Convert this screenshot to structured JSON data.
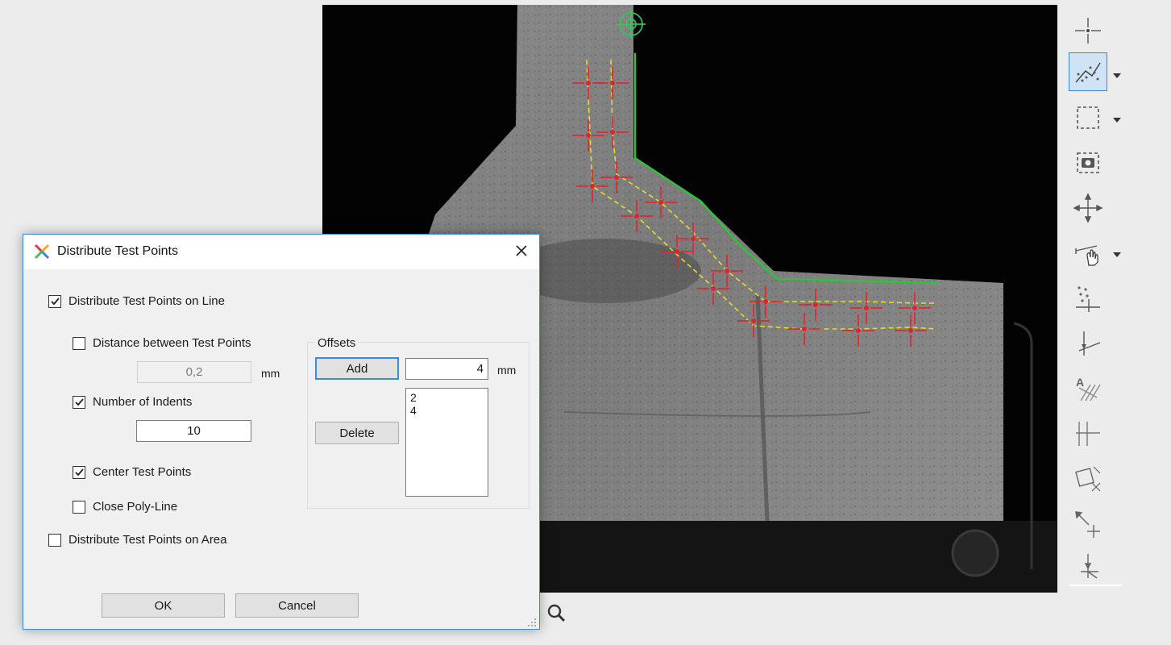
{
  "dialog": {
    "title": "Distribute Test Points",
    "close_label": "✕",
    "distribute_on_line": {
      "label": "Distribute Test Points on Line",
      "checked": true
    },
    "distance_between": {
      "label": "Distance between Test Points",
      "checked": false,
      "value": "0,2",
      "unit": "mm"
    },
    "number_of_indents": {
      "label": "Number of Indents",
      "checked": true,
      "value": "10"
    },
    "center_test_points": {
      "label": "Center Test Points",
      "checked": true
    },
    "close_poly_line": {
      "label": "Close Poly-Line",
      "checked": false
    },
    "distribute_on_area": {
      "label": "Distribute Test Points on Area",
      "checked": false
    },
    "offsets": {
      "group_label": "Offsets",
      "add_label": "Add",
      "delete_label": "Delete",
      "input_value": "4",
      "unit": "mm",
      "items": [
        "2",
        "4"
      ]
    },
    "ok_label": "OK",
    "cancel_label": "Cancel"
  },
  "toolbar": {
    "tools": [
      "crosshair-point-icon",
      "distribute-line-points-icon",
      "rectangle-select-icon",
      "camera-capture-icon",
      "move-arrows-icon",
      "hand-pointer-icon",
      "point-grid-icon",
      "angle-line-icon",
      "text-hatch-icon",
      "perpendicular-icon",
      "rotate-rectangle-icon",
      "diagonal-arrows-icon",
      "corner-arrow-icon"
    ],
    "active_tool": "distribute-line-points-icon"
  },
  "colors": {
    "accent": "#3c8ad8",
    "test_point": "#e8202a",
    "path_line": "#e6dc2a",
    "edge_line": "#2fc23a",
    "marker": "#3fbf5a"
  }
}
